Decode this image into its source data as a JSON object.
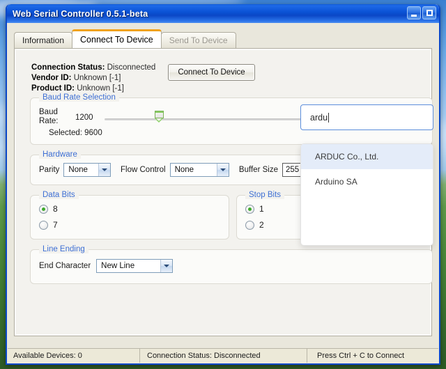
{
  "window": {
    "title": "Web Serial Controller 0.5.1-beta",
    "minimize_icon": "minimize-icon",
    "maximize_icon": "maximize-icon"
  },
  "tabs": [
    {
      "label": "Information",
      "state": "normal"
    },
    {
      "label": "Connect To Device",
      "state": "active"
    },
    {
      "label": "Send To Device",
      "state": "disabled"
    }
  ],
  "status_block": {
    "connection_status_label": "Connection Status:",
    "connection_status_value": "Disconnected",
    "vendor_id_label": "Vendor ID:",
    "vendor_id_value": "Unknown [-1]",
    "product_id_label": "Product ID:",
    "product_id_value": "Unknown [-1]"
  },
  "connect_button": {
    "label": "Connect To Device"
  },
  "search": {
    "value": "ardu",
    "suggestions": [
      {
        "label": "ARDUC Co., Ltd.",
        "highlighted": true
      },
      {
        "label": "Arduino SA",
        "highlighted": false
      }
    ]
  },
  "baud": {
    "legend": "Baud Rate Selection",
    "label": "Baud\nRate:",
    "label_line1": "Baud",
    "label_line2": "Rate:",
    "min_label": "1200",
    "selected_text": "Selected: 9600",
    "selected_value": 9600,
    "thumb_position_percent": 15
  },
  "hardware": {
    "legend": "Hardware",
    "parity_label": "Parity",
    "parity_value": "None",
    "flow_control_label": "Flow Control",
    "flow_control_value": "None",
    "buffer_size_label": "Buffer Size",
    "buffer_size_value": "255"
  },
  "data_bits": {
    "legend": "Data Bits",
    "options": [
      {
        "label": "8",
        "checked": true
      },
      {
        "label": "7",
        "checked": false
      }
    ]
  },
  "stop_bits": {
    "legend": "Stop Bits",
    "options": [
      {
        "label": "1",
        "checked": true
      },
      {
        "label": "2",
        "checked": false
      }
    ]
  },
  "line_ending": {
    "legend": "Line Ending",
    "end_character_label": "End Character",
    "end_character_value": "New Line"
  },
  "statusbar": {
    "available_devices": "Available Devices: 0",
    "connection_status": "Connection Status: Disconnected",
    "hint": "Press Ctrl + C to Connect"
  },
  "colors": {
    "titlebar_blue": "#0b53d6",
    "window_border": "#0a48c8",
    "legend_blue": "#3e6fd4",
    "active_tab_accent": "#f0a21e",
    "radio_dot_green": "#3faa2e",
    "slider_green": "#8fd26a",
    "focus_border": "#5b8ddb",
    "suggest_highlight": "#e4ecf9"
  }
}
